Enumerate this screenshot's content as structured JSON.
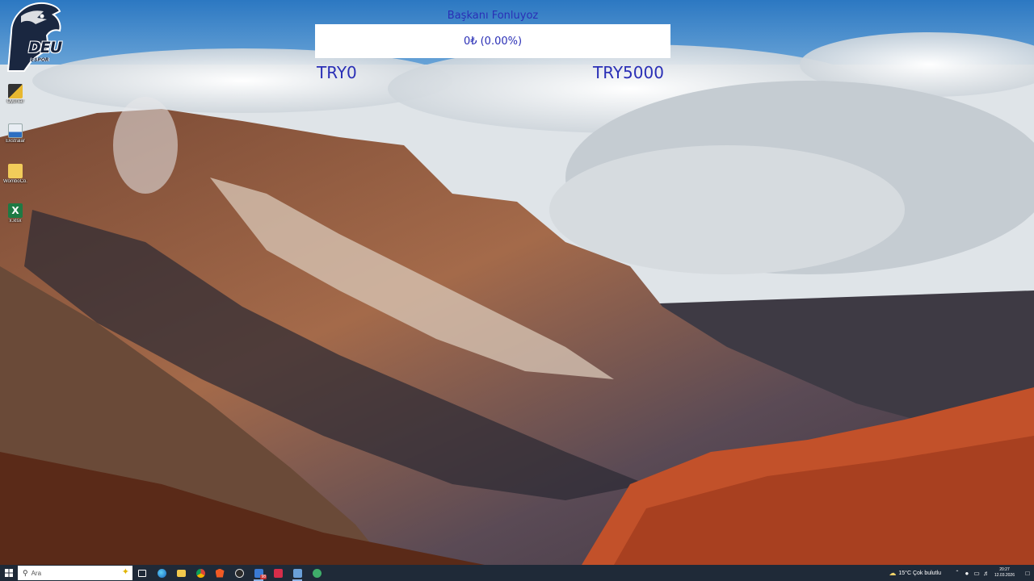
{
  "widget": {
    "title": "Başkanı Fonluyoz",
    "progress_text": "0₺ (0.00%)",
    "progress_fraction": 0.0,
    "min_label": "TRY0",
    "max_label": "TRY5000",
    "accent_color": "#2a2fb6",
    "box_color": "#ffffff"
  },
  "logo": {
    "text": "DEU",
    "subtext": "ESPOR",
    "icon": "horse-head-icon"
  },
  "desktop_icons": [
    {
      "label": "Oyunlar",
      "icon": "folder-shortcut-icon"
    },
    {
      "label": "Ekstralar",
      "icon": "app-shortcut-icon"
    },
    {
      "label": "WomboCo...",
      "icon": "folder-icon"
    },
    {
      "label": "x.xlsx",
      "icon": "excel-file-icon"
    }
  ],
  "taskbar": {
    "search_placeholder": "Ara",
    "apps": [
      {
        "name": "task-view",
        "icon": "task-view-icon"
      },
      {
        "name": "edge",
        "icon": "edge-icon"
      },
      {
        "name": "file-explorer",
        "icon": "folder-icon"
      },
      {
        "name": "chrome",
        "icon": "chrome-icon"
      },
      {
        "name": "brave",
        "icon": "brave-icon"
      },
      {
        "name": "obs",
        "icon": "obs-icon"
      },
      {
        "name": "app-with-badge",
        "icon": "app-icon",
        "badge": "98"
      },
      {
        "name": "red-app",
        "icon": "red-app-icon"
      },
      {
        "name": "app-generic",
        "icon": "app-icon"
      },
      {
        "name": "app-green",
        "icon": "app-icon"
      }
    ],
    "weather_text": "15°C  Çok bulutlu",
    "time": "20:27",
    "date": "12.03.2026"
  }
}
